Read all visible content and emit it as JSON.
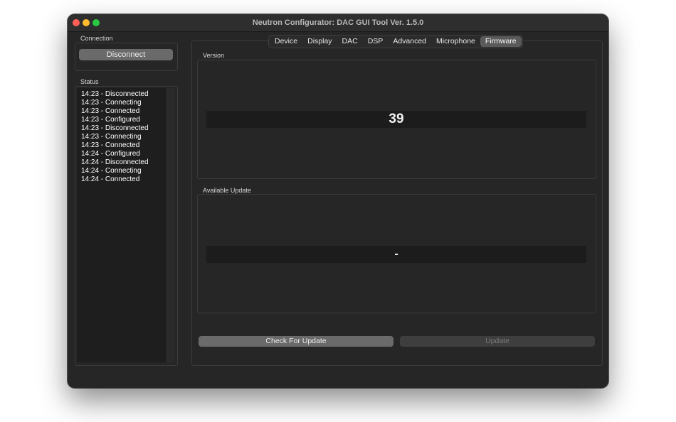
{
  "window": {
    "title": "Neutron Configurator: DAC GUI Tool Ver. 1.5.0"
  },
  "connection": {
    "label": "Connection",
    "disconnect_label": "Disconnect"
  },
  "status": {
    "label": "Status",
    "lines": [
      "14:23 - Disconnected",
      "14:23 - Connecting",
      "14:23 - Connected",
      "14:23 - Configured",
      "14:23 - Disconnected",
      "14:23 - Connecting",
      "14:23 - Connected",
      "14:24 - Configured",
      "14:24 - Disconnected",
      "14:24 - Connecting",
      "14:24 - Connected"
    ]
  },
  "tabs": [
    {
      "label": "Device",
      "active": false
    },
    {
      "label": "Display",
      "active": false
    },
    {
      "label": "DAC",
      "active": false
    },
    {
      "label": "DSP",
      "active": false
    },
    {
      "label": "Advanced",
      "active": false
    },
    {
      "label": "Microphone",
      "active": false
    },
    {
      "label": "Firmware",
      "active": true
    }
  ],
  "firmware": {
    "version_label": "Version",
    "version_value": "39",
    "update_label": "Available Update",
    "update_value": "-",
    "check_label": "Check For Update",
    "update_button_label": "Update"
  },
  "colors": {
    "window_bg": "#262626",
    "close": "#ff5f57",
    "minimize": "#febc2e",
    "maximize": "#28c840"
  }
}
